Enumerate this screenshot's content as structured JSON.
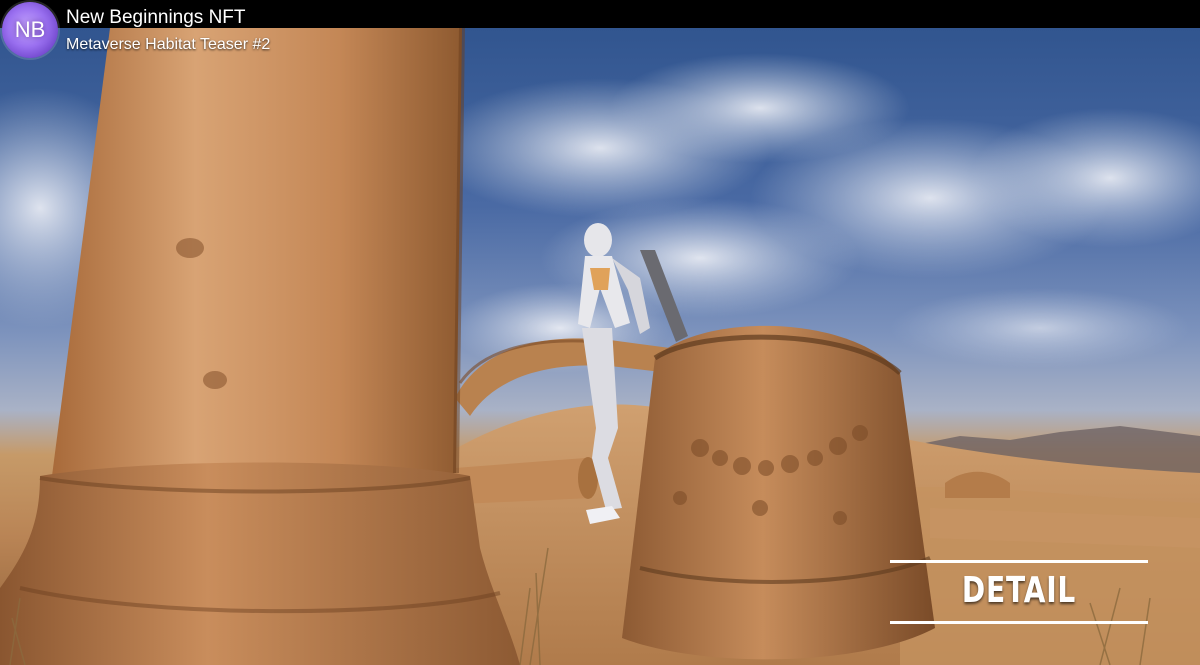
{
  "channel": {
    "avatar_text": "NB",
    "title": "New Beginnings NFT",
    "subtitle": "Metaverse Habitat Teaser #2"
  },
  "overlay": {
    "detail_label": "DETAIL"
  },
  "colors": {
    "avatar": "#9a70f0",
    "sky": "#4a6aa4",
    "sand": "#c69a68",
    "detail_text": "#ffffff"
  }
}
